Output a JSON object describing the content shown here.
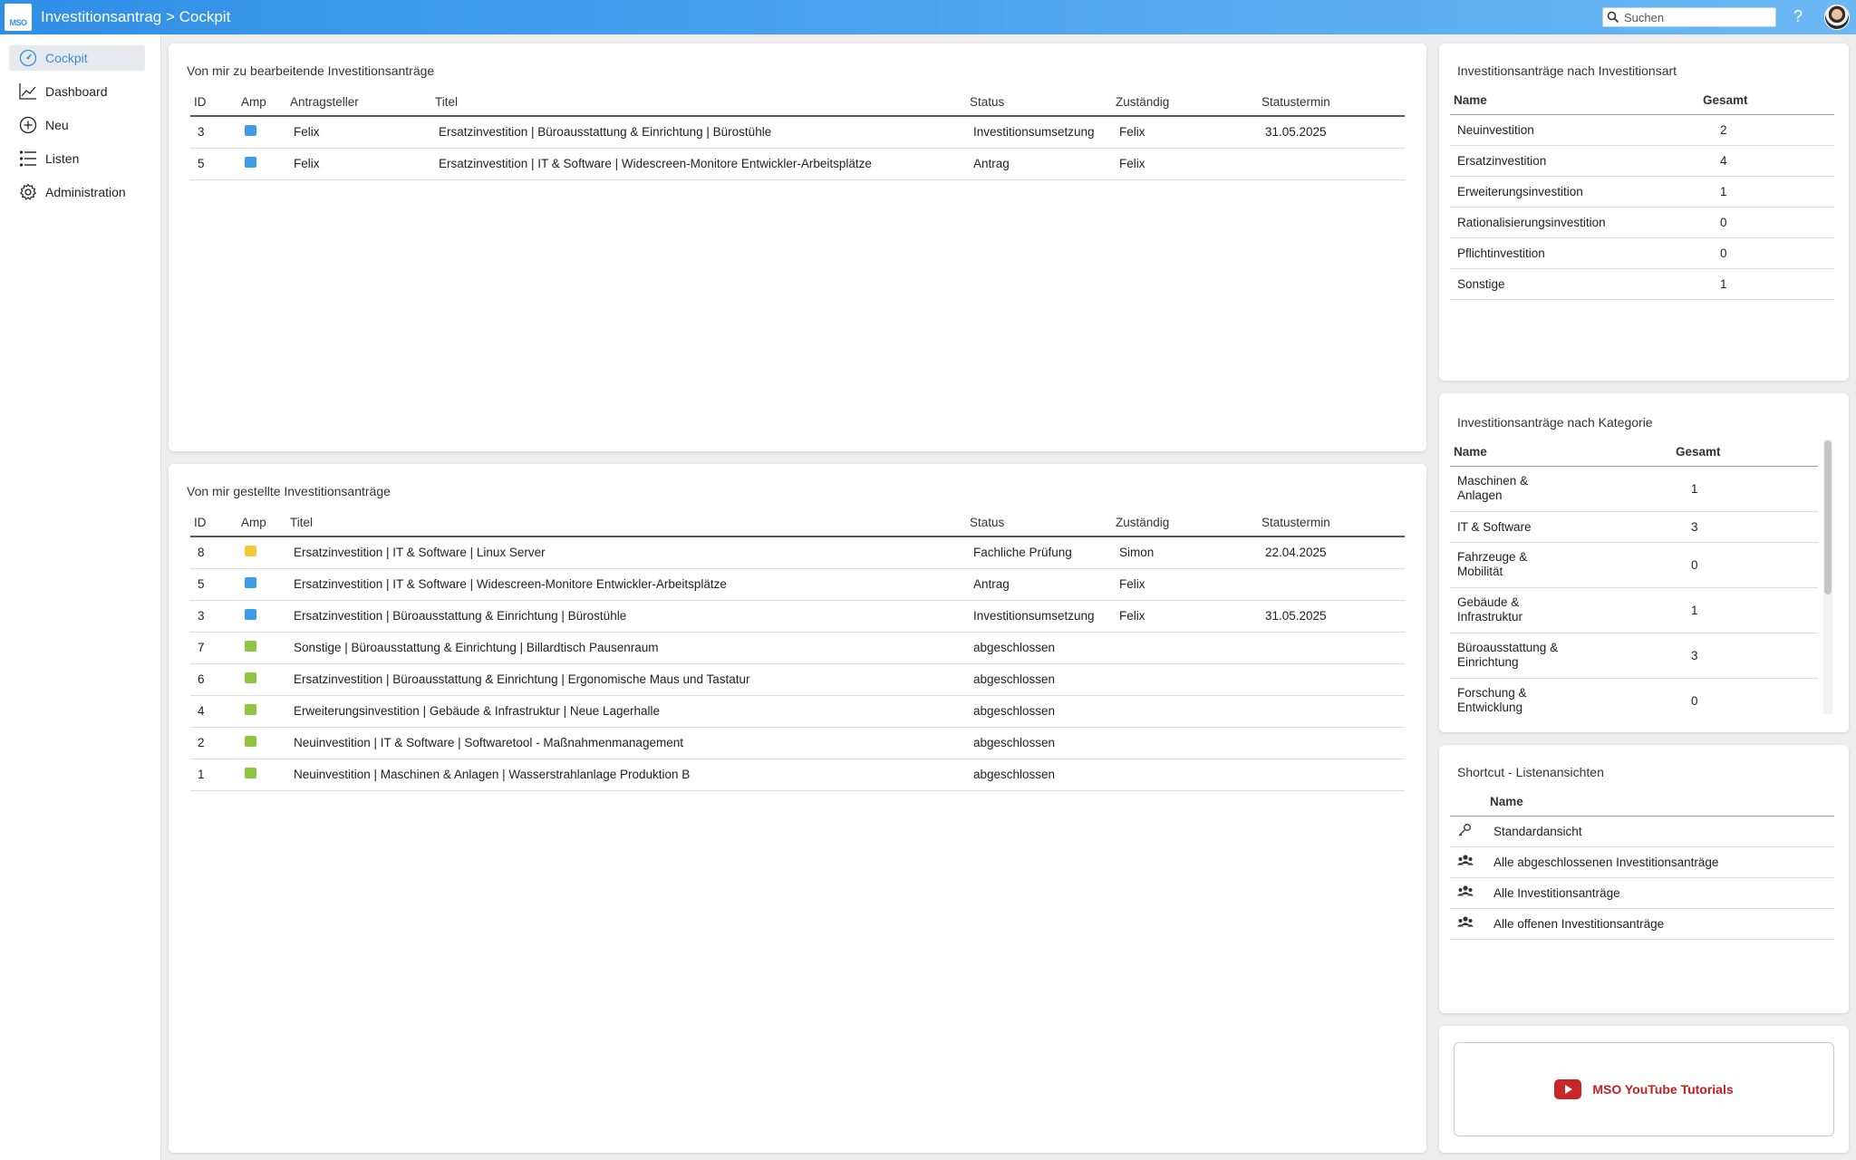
{
  "header": {
    "logo_text": "MSO",
    "title": "Investitionsantrag > Cockpit",
    "search_placeholder": "Suchen",
    "help_label": "?"
  },
  "sidebar": {
    "items": [
      {
        "label": "Cockpit",
        "icon": "gauge-icon"
      },
      {
        "label": "Dashboard",
        "icon": "chart-line-icon"
      },
      {
        "label": "Neu",
        "icon": "plus-circle-icon"
      },
      {
        "label": "Listen",
        "icon": "list-icon"
      },
      {
        "label": "Administration",
        "icon": "gear-icon"
      }
    ]
  },
  "colors": {
    "blue": "#3f9be5",
    "yellow": "#f0cc3a",
    "green": "#8cc63f",
    "accent": "#3a8fd9"
  },
  "todo": {
    "title": "Von mir zu bearbeitende Investitionsanträge",
    "headers": [
      "ID",
      "Amp",
      "Antragsteller",
      "Titel",
      "Status",
      "Zuständig",
      "Statustermin"
    ],
    "rows": [
      {
        "id": "3",
        "amp": "blue",
        "applicant": "Felix",
        "title": "Ersatzinvestition | Büroausstattung & Einrichtung | Bürostühle",
        "status": "Investitionsumsetzung",
        "owner": "Felix",
        "date": "31.05.2025"
      },
      {
        "id": "5",
        "amp": "blue",
        "applicant": "Felix",
        "title": "Ersatzinvestition | IT & Software | Widescreen-Monitore Entwickler-Arbeitsplätze",
        "status": "Antrag",
        "owner": "Felix",
        "date": ""
      }
    ]
  },
  "mine": {
    "title": "Von mir gestellte Investitionsanträge",
    "headers": [
      "ID",
      "Amp",
      "Titel",
      "Status",
      "Zuständig",
      "Statustermin"
    ],
    "rows": [
      {
        "id": "8",
        "amp": "yellow",
        "title": "Ersatzinvestition | IT & Software | Linux Server",
        "status": "Fachliche Prüfung",
        "owner": "Simon",
        "date": "22.04.2025"
      },
      {
        "id": "5",
        "amp": "blue",
        "title": "Ersatzinvestition | IT & Software | Widescreen-Monitore Entwickler-Arbeitsplätze",
        "status": "Antrag",
        "owner": "Felix",
        "date": ""
      },
      {
        "id": "3",
        "amp": "blue",
        "title": "Ersatzinvestition | Büroausstattung & Einrichtung | Bürostühle",
        "status": "Investitionsumsetzung",
        "owner": "Felix",
        "date": "31.05.2025"
      },
      {
        "id": "7",
        "amp": "green",
        "title": "Sonstige | Büroausstattung & Einrichtung | Billardtisch Pausenraum",
        "status": "abgeschlossen",
        "owner": "",
        "date": ""
      },
      {
        "id": "6",
        "amp": "green",
        "title": "Ersatzinvestition | Büroausstattung & Einrichtung | Ergonomische Maus und Tastatur",
        "status": "abgeschlossen",
        "owner": "",
        "date": ""
      },
      {
        "id": "4",
        "amp": "green",
        "title": "Erweiterungsinvestition | Gebäude & Infrastruktur | Neue Lagerhalle",
        "status": "abgeschlossen",
        "owner": "",
        "date": ""
      },
      {
        "id": "2",
        "amp": "green",
        "title": "Neuinvestition | IT & Software | Softwaretool - Maßnahmenmanagement",
        "status": "abgeschlossen",
        "owner": "",
        "date": ""
      },
      {
        "id": "1",
        "amp": "green",
        "title": "Neuinvestition | Maschinen & Anlagen | Wasserstrahlanlage Produktion B",
        "status": "abgeschlossen",
        "owner": "",
        "date": ""
      }
    ]
  },
  "by_type": {
    "title": "Investitionsanträge nach Investitionsart",
    "headers": [
      "Name",
      "Gesamt"
    ],
    "rows": [
      {
        "name": "Neuinvestition",
        "total": "2"
      },
      {
        "name": "Ersatzinvestition",
        "total": "4"
      },
      {
        "name": "Erweiterungsinvestition",
        "total": "1"
      },
      {
        "name": "Rationalisierungsinvestition",
        "total": "0"
      },
      {
        "name": "Pflichtinvestition",
        "total": "0"
      },
      {
        "name": "Sonstige",
        "total": "1"
      }
    ]
  },
  "by_category": {
    "title": "Investitionsanträge nach Kategorie",
    "headers": [
      "Name",
      "Gesamt"
    ],
    "rows": [
      {
        "name": "Maschinen & Anlagen",
        "total": "1"
      },
      {
        "name": "IT & Software",
        "total": "3"
      },
      {
        "name": "Fahrzeuge & Mobilität",
        "total": "0"
      },
      {
        "name": "Gebäude & Infrastruktur",
        "total": "1"
      },
      {
        "name": "Büroausstattung & Einrichtung",
        "total": "3"
      },
      {
        "name": "Forschung & Entwicklung",
        "total": "0"
      }
    ]
  },
  "shortcuts": {
    "title": "Shortcut - Listenansichten",
    "header": "Name",
    "rows": [
      {
        "name": "Standardansicht",
        "icon": "key-icon"
      },
      {
        "name": "Alle abgeschlossenen Investitionsanträge",
        "icon": "users-icon"
      },
      {
        "name": "Alle Investitionsanträge",
        "icon": "users-icon"
      },
      {
        "name": "Alle offenen Investitionsanträge",
        "icon": "users-icon"
      }
    ]
  },
  "youtube": {
    "label": "MSO YouTube Tutorials",
    "icon": "youtube-icon"
  }
}
